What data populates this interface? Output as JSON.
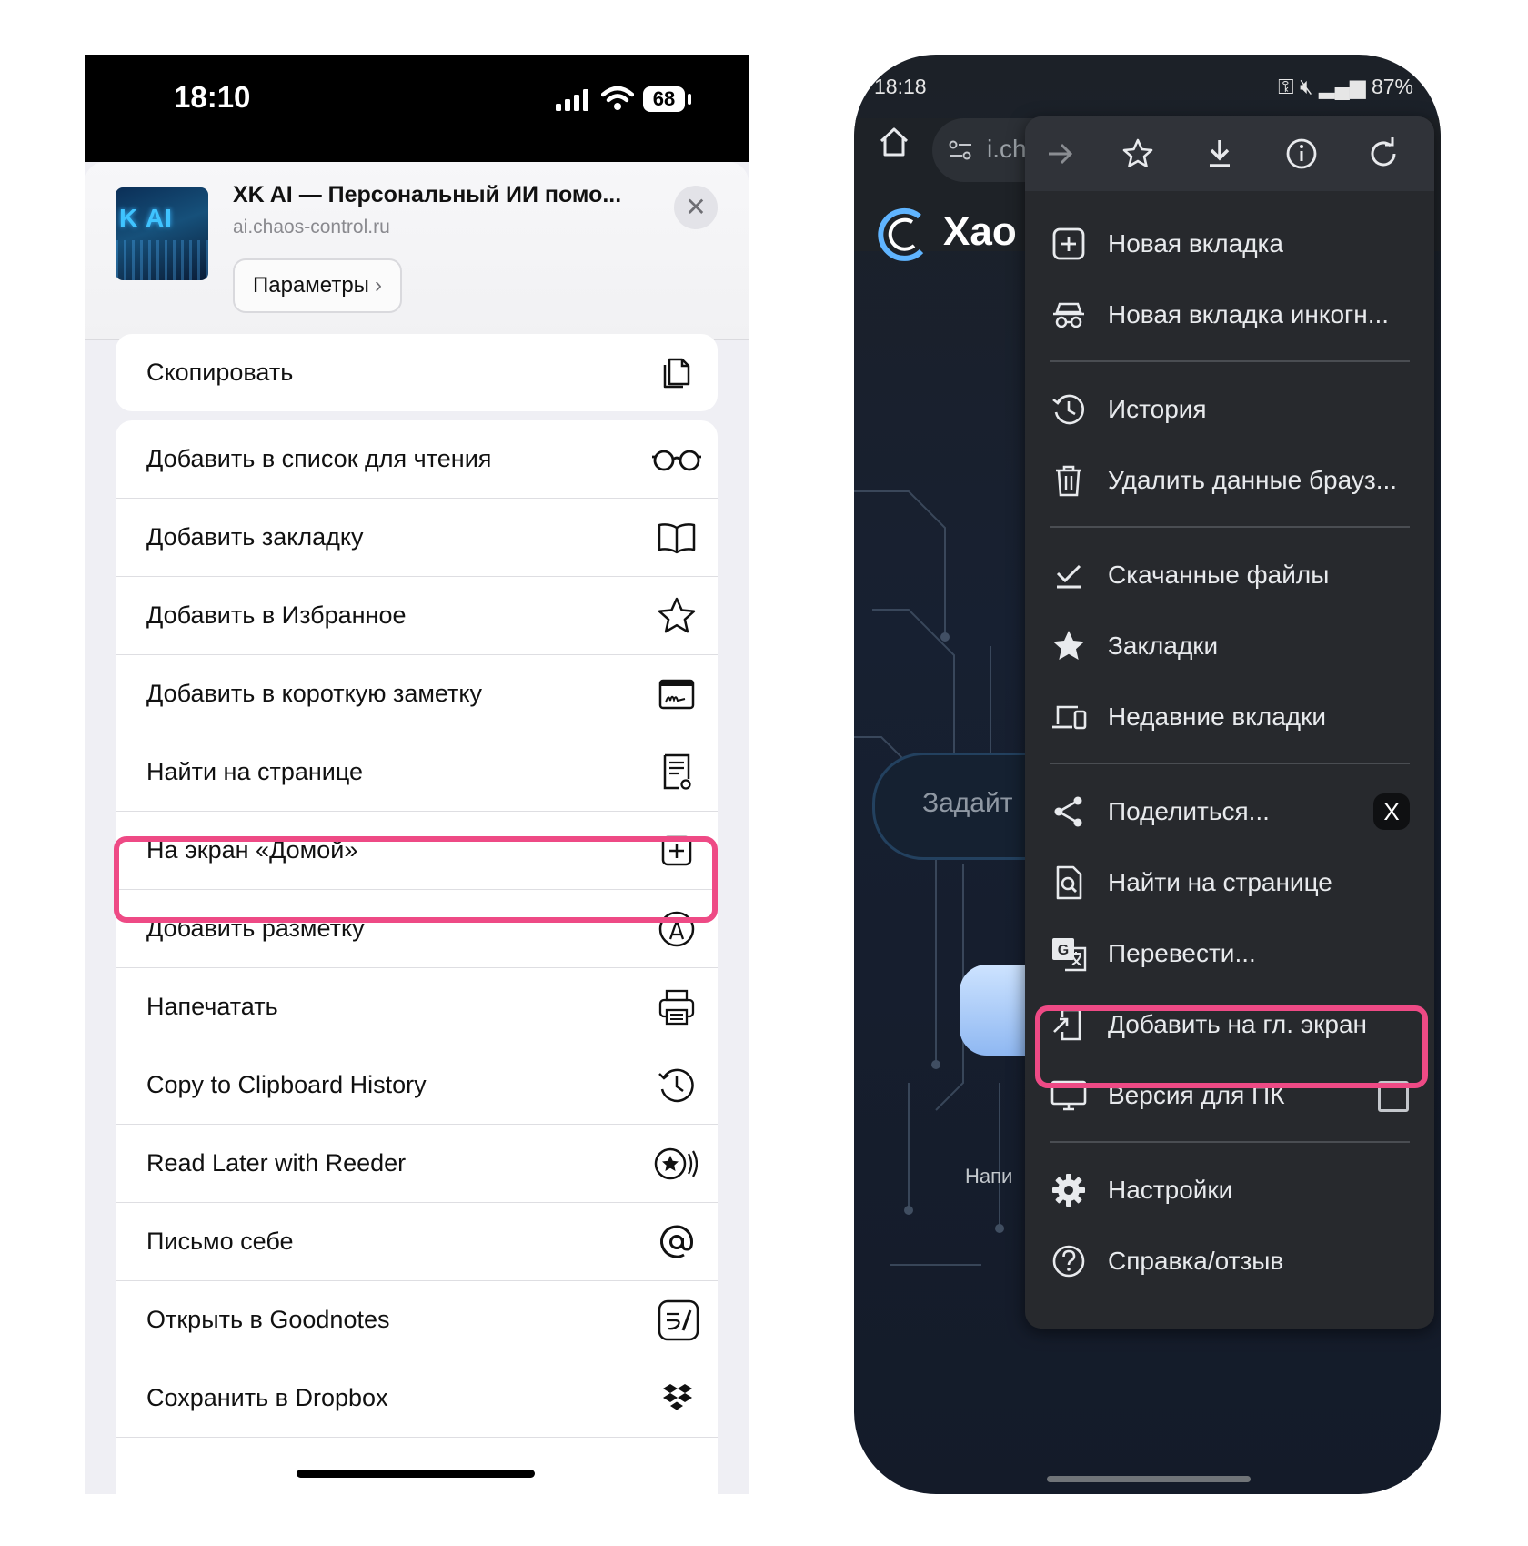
{
  "ios": {
    "status": {
      "time": "18:10",
      "battery": "68"
    },
    "header": {
      "thumb_text": "K AI",
      "title": "XK AI — Персональный ИИ помо...",
      "url": "ai.chaos-control.ru",
      "params_label": "Параметры"
    },
    "copy_group": [
      {
        "label": "Скопировать",
        "icon": "copy-icon"
      }
    ],
    "actions": [
      {
        "label": "Добавить в список для чтения",
        "icon": "glasses-icon"
      },
      {
        "label": "Добавить закладку",
        "icon": "book-icon"
      },
      {
        "label": "Добавить в Избранное",
        "icon": "star-icon"
      },
      {
        "label": "Добавить в короткую заметку",
        "icon": "quick-note-icon"
      },
      {
        "label": "Найти на странице",
        "icon": "find-page-icon"
      },
      {
        "label": "На экран «Домой»",
        "icon": "add-square-icon",
        "highlighted": true
      },
      {
        "label": "Добавить разметку",
        "icon": "markup-icon"
      },
      {
        "label": "Напечатать",
        "icon": "printer-icon"
      },
      {
        "label": "Copy to Clipboard History",
        "icon": "history-icon"
      },
      {
        "label": "Read Later with Reeder",
        "icon": "reeder-icon"
      },
      {
        "label": "Письмо себе",
        "icon": "at-icon"
      },
      {
        "label": "Открыть в Goodnotes",
        "icon": "goodnotes-icon"
      },
      {
        "label": "Сохранить в Dropbox",
        "icon": "dropbox-icon"
      }
    ],
    "highlight_color": "#ee4a85"
  },
  "android": {
    "status": {
      "time": "18:18",
      "battery": "87%"
    },
    "url_fragment": "i.ch",
    "page_title": "Хао",
    "ask_placeholder": "Задайт",
    "hint_fragment": "Напи",
    "toolbar_icons": [
      "forward-icon",
      "bookmark-star-icon",
      "download-icon",
      "info-icon",
      "reload-icon"
    ],
    "menu": [
      {
        "label": "Новая вкладка",
        "icon": "new-tab-icon"
      },
      {
        "label": "Новая вкладка инкогн...",
        "icon": "incognito-icon"
      },
      {
        "label": "История",
        "icon": "history-icon"
      },
      {
        "label": "Удалить данные брауз...",
        "icon": "trash-icon"
      },
      {
        "label": "Скачанные файлы",
        "icon": "downloads-icon"
      },
      {
        "label": "Закладки",
        "icon": "star-icon"
      },
      {
        "label": "Недавние вкладки",
        "icon": "devices-icon"
      },
      {
        "label": "Поделиться...",
        "icon": "share-icon",
        "badge": "X"
      },
      {
        "label": "Найти на странице",
        "icon": "find-page-icon"
      },
      {
        "label": "Перевести...",
        "icon": "translate-icon"
      },
      {
        "label": "Добавить на гл. экран",
        "icon": "add-home-icon",
        "highlighted": true
      },
      {
        "label": "Версия для ПК",
        "icon": "desktop-icon",
        "checkbox": false
      },
      {
        "label": "Настройки",
        "icon": "gear-icon"
      },
      {
        "label": "Справка/отзыв",
        "icon": "help-icon"
      }
    ],
    "highlight_color": "#ee4a85"
  }
}
